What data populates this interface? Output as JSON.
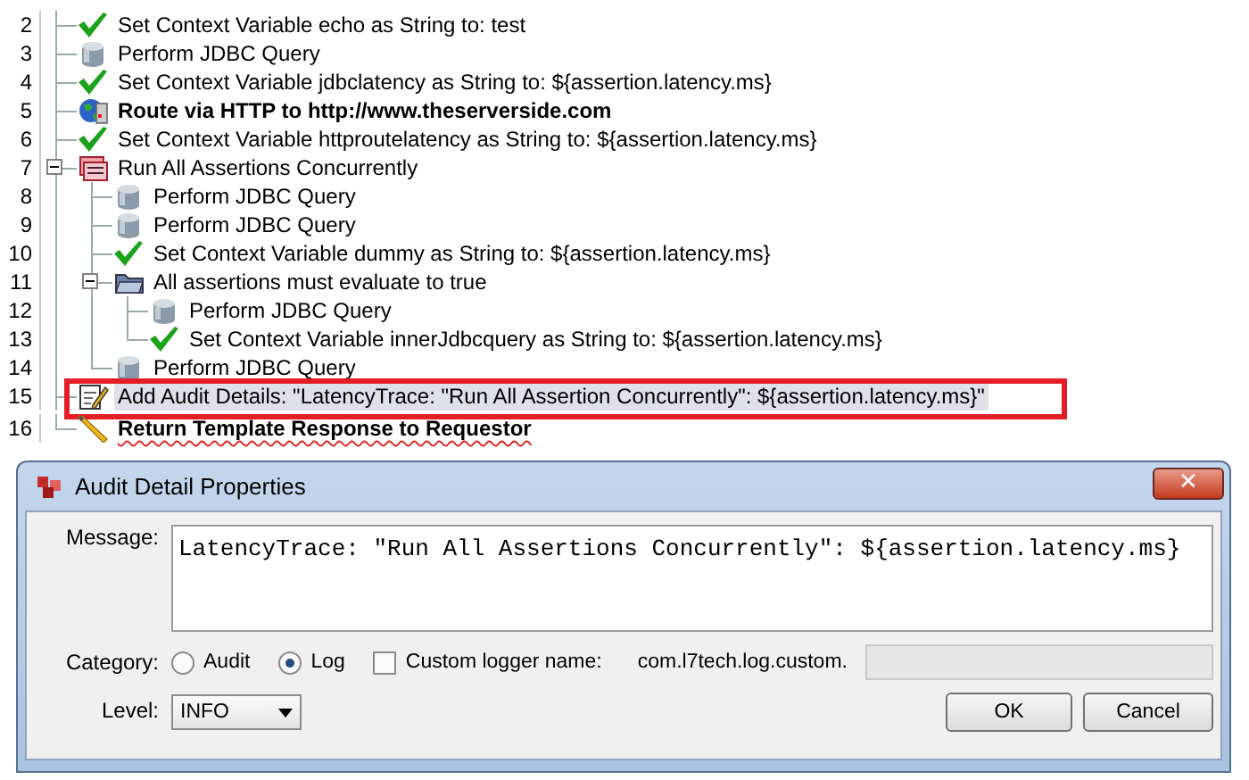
{
  "policy_tree": {
    "rows": [
      {
        "line": "2",
        "kind": "check",
        "text": "Set Context Variable echo as String to: test",
        "bold": false,
        "selected": false,
        "warning": false,
        "annotated": false
      },
      {
        "line": "3",
        "kind": "database",
        "text": "Perform JDBC Query",
        "bold": false,
        "selected": false,
        "warning": false,
        "annotated": false
      },
      {
        "line": "4",
        "kind": "check",
        "text": "Set Context Variable jdbclatency as String to: ${assertion.latency.ms}",
        "bold": false,
        "selected": false,
        "warning": false,
        "annotated": false
      },
      {
        "line": "5",
        "kind": "globe",
        "text": "Route via HTTP to http://www.theserverside.com",
        "bold": true,
        "selected": false,
        "warning": false,
        "annotated": false
      },
      {
        "line": "6",
        "kind": "check",
        "text": "Set Context Variable httproutelatency as String to: ${assertion.latency.ms}",
        "bold": false,
        "selected": false,
        "warning": false,
        "annotated": false
      },
      {
        "line": "7",
        "kind": "concurrent",
        "text": "Run All Assertions Concurrently",
        "bold": false,
        "selected": false,
        "warning": false,
        "annotated": false,
        "expanded": true,
        "children": [
          {
            "line": "8",
            "kind": "database",
            "text": "Perform JDBC Query",
            "bold": false,
            "selected": false,
            "warning": false,
            "annotated": false
          },
          {
            "line": "9",
            "kind": "database",
            "text": "Perform JDBC Query",
            "bold": false,
            "selected": false,
            "warning": false,
            "annotated": false
          },
          {
            "line": "10",
            "kind": "check",
            "text": "Set Context Variable dummy as String to: ${assertion.latency.ms}",
            "bold": false,
            "selected": false,
            "warning": false,
            "annotated": false
          },
          {
            "line": "11",
            "kind": "folder",
            "text": "All assertions must evaluate to true",
            "bold": false,
            "selected": false,
            "warning": false,
            "annotated": false,
            "expanded": true,
            "children": [
              {
                "line": "12",
                "kind": "database",
                "text": "Perform JDBC Query",
                "bold": false,
                "selected": false,
                "warning": false,
                "annotated": false
              },
              {
                "line": "13",
                "kind": "check",
                "text": "Set Context Variable innerJdbcquery as String to: ${assertion.latency.ms}",
                "bold": false,
                "selected": false,
                "warning": false,
                "annotated": false
              }
            ]
          },
          {
            "line": "14",
            "kind": "database",
            "text": "Perform JDBC Query",
            "bold": false,
            "selected": false,
            "warning": false,
            "annotated": false
          }
        ]
      },
      {
        "line": "15",
        "kind": "notepad",
        "text": "Add Audit Details: \"LatencyTrace: \"Run All Assertion Concurrently\": ${assertion.latency.ms}\"",
        "bold": false,
        "selected": true,
        "warning": false,
        "annotated": true
      },
      {
        "line": "16",
        "kind": "pencil",
        "text": "Return Template Response to Requestor",
        "bold": true,
        "selected": false,
        "warning": true,
        "annotated": false
      }
    ]
  },
  "dialog": {
    "title": "Audit Detail Properties",
    "close": "✕",
    "message": {
      "label": "Message:",
      "value": "LatencyTrace: \"Run All Assertions Concurrently\": ${assertion.latency.ms}"
    },
    "category": {
      "label": "Category:",
      "options": [
        {
          "label": "Audit",
          "selected": false
        },
        {
          "label": "Log",
          "selected": true
        }
      ]
    },
    "custom_logger": {
      "label": "Custom logger name:",
      "checked": false,
      "prefix": "com.l7tech.log.custom.",
      "disabled": true
    },
    "level": {
      "label": "Level:",
      "value": "INFO"
    },
    "buttons": [
      "OK",
      "Cancel"
    ]
  }
}
